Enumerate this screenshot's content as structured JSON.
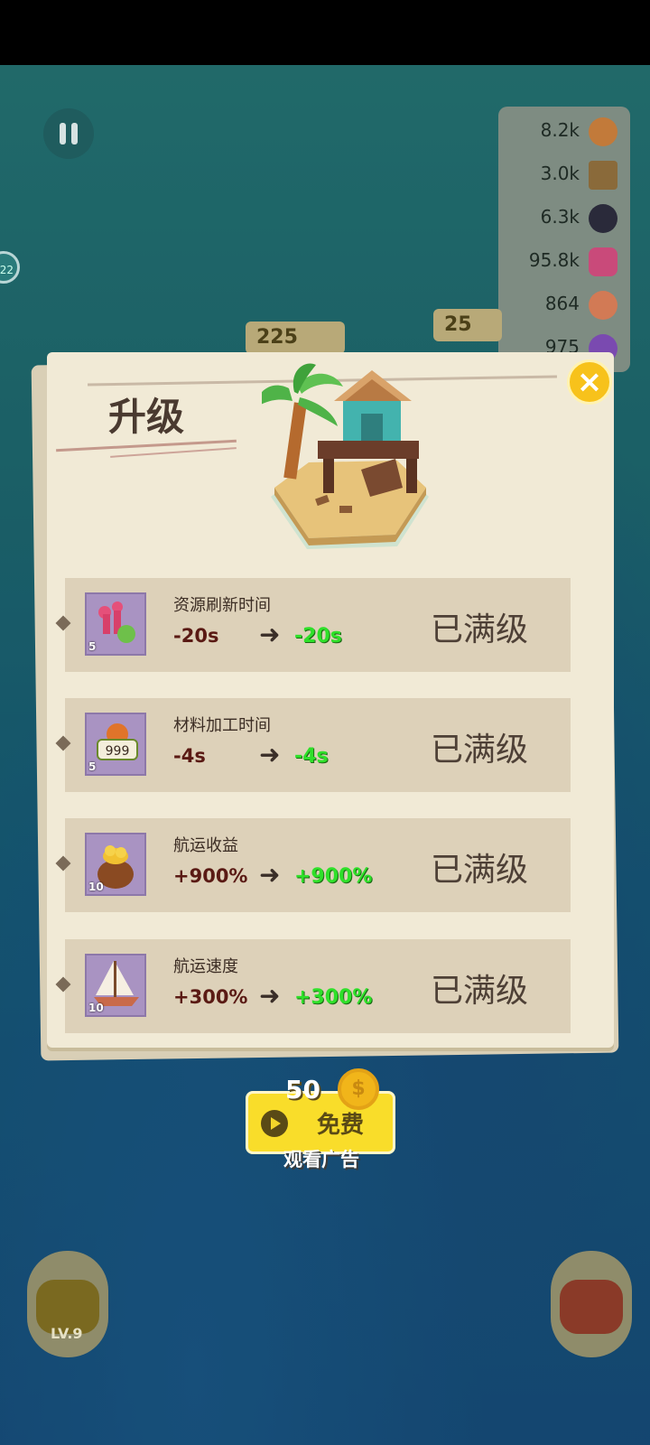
{
  "resources": [
    {
      "value": "8.2k",
      "icon": "coconut-icon",
      "color": "#c27a3a"
    },
    {
      "value": "3.0k",
      "icon": "wood-crate-icon",
      "color": "#8a6a3a"
    },
    {
      "value": "6.3k",
      "icon": "bomb-icon",
      "color": "#2a2a3a"
    },
    {
      "value": "95.8k",
      "icon": "coral-icon",
      "color": "#c94a7a"
    },
    {
      "value": "864",
      "icon": "fish-steak-icon",
      "color": "#d27a55"
    },
    {
      "value": "975",
      "icon": "pearl-icon",
      "color": "#7a4ab0"
    }
  ],
  "map_tags": {
    "left": "225",
    "right": "25"
  },
  "panel": {
    "title": "升级",
    "close_icon": "close-icon"
  },
  "upgrades": [
    {
      "label": "资源刷新时间",
      "from": "-20s",
      "to": "-20s",
      "status": "已满级",
      "level": "5",
      "icon": "coral-refresh-icon"
    },
    {
      "label": "材料加工时间",
      "from": "-4s",
      "to": "-4s",
      "status": "已满级",
      "level": "5",
      "icon": "material-999-icon",
      "icon_text": "999"
    },
    {
      "label": "航运收益",
      "from": "+900%",
      "to": "+900%",
      "status": "已满级",
      "level": "10",
      "icon": "gold-sack-icon"
    },
    {
      "label": "航运速度",
      "from": "+300%",
      "to": "+300%",
      "status": "已满级",
      "level": "10",
      "icon": "sailboat-icon"
    }
  ],
  "ad": {
    "amount": "50",
    "free_label": "免费",
    "watch_label": "观看广告"
  },
  "bottom": {
    "left_level": "LV.9"
  }
}
